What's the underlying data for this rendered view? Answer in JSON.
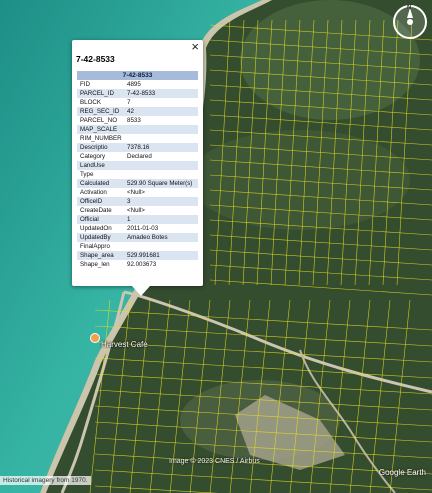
{
  "popup": {
    "title": "7-42-8533",
    "close_label": "×",
    "table_header": "7-42-8533",
    "rows": [
      {
        "key": "FID",
        "value": "4895"
      },
      {
        "key": "PARCEL_ID",
        "value": "7-42-8533"
      },
      {
        "key": "BLOCK",
        "value": "7"
      },
      {
        "key": "REG_SEC_ID",
        "value": "42"
      },
      {
        "key": "PARCEL_NO",
        "value": "8533"
      },
      {
        "key": "MAP_SCALE",
        "value": ""
      },
      {
        "key": "RIM_NUMBER",
        "value": ""
      },
      {
        "key": "Descriptio",
        "value": "7378.16"
      },
      {
        "key": "Category",
        "value": "Declared"
      },
      {
        "key": "LandUse",
        "value": ""
      },
      {
        "key": "Type",
        "value": ""
      },
      {
        "key": "Calculated",
        "value": "529.90 Square Meter(s)"
      },
      {
        "key": "Activation",
        "value": "<Null>"
      },
      {
        "key": "OfficeID",
        "value": "3"
      },
      {
        "key": "CreateDate",
        "value": "<Null>"
      },
      {
        "key": "Official",
        "value": "1"
      },
      {
        "key": "UpdatedOn",
        "value": "2011-01-03"
      },
      {
        "key": "UpdatedBy",
        "value": "Amadeo Botes"
      },
      {
        "key": "FinalAppro",
        "value": ""
      },
      {
        "key": "Shape_area",
        "value": "529.991681"
      },
      {
        "key": "Shape_len",
        "value": "92.003673"
      }
    ]
  },
  "map": {
    "place_name": "Harvest Cafe",
    "attribution": "Image © 2023 CNES / Airbus",
    "historical_note": "Historical imagery from 1970.",
    "logo": "Google Earth",
    "compass_label": "N",
    "parcel_line_color": "#e8e020",
    "water_color": "#2aa89c",
    "land_color": "#2e4a2b"
  }
}
